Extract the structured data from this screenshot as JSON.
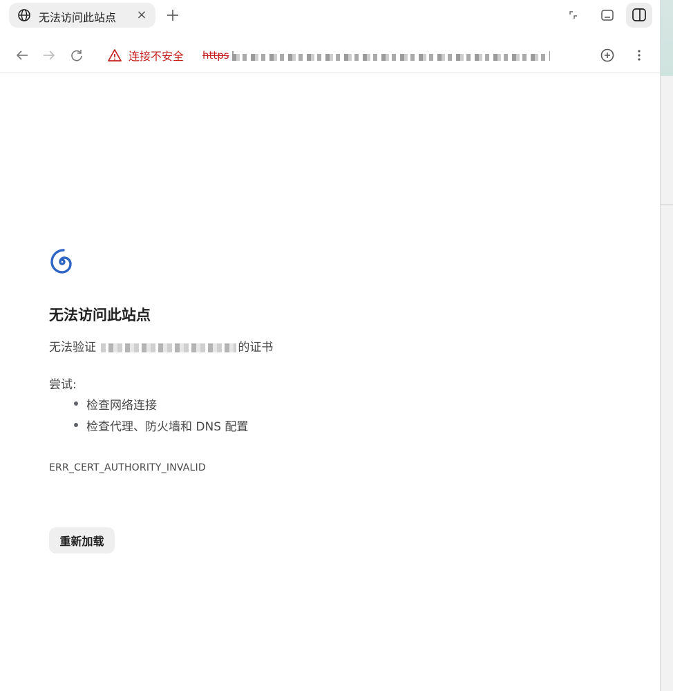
{
  "tab": {
    "title": "无法访问此站点",
    "close_glyph": "×",
    "icon": "globe-icon"
  },
  "toolbar": {
    "security_label": "连接不安全",
    "url_scheme": "https"
  },
  "page": {
    "icon": "spiral-error-icon",
    "heading": "无法访问此站点",
    "desc_prefix": "无法验证",
    "desc_suffix": "的证书",
    "try_label": "尝试:",
    "suggestions": [
      "检查网络连接",
      "检查代理、防火墙和 DNS 配置"
    ],
    "error_code": "ERR_CERT_AUTHORITY_INVALID",
    "reload_label": "重新加载"
  },
  "colors": {
    "accent_blue": "#2e64c3",
    "warning_red": "#c5221f"
  }
}
